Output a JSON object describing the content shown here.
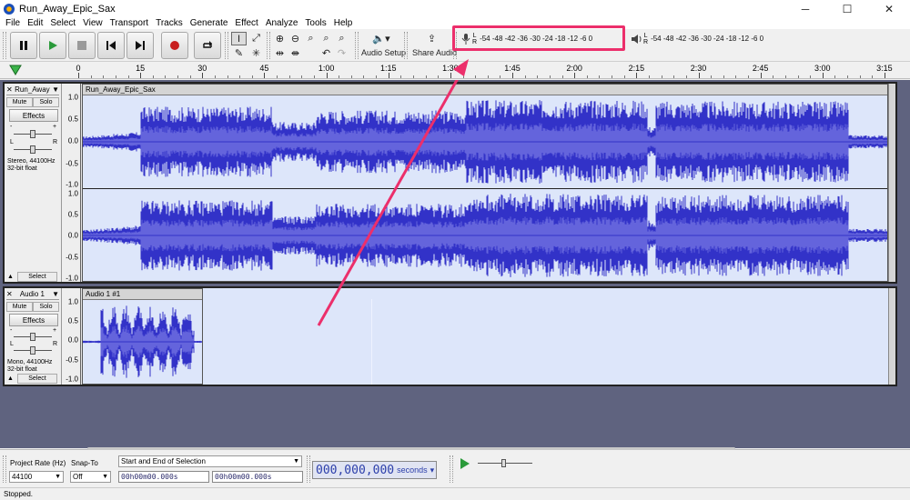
{
  "window": {
    "title": "Run_Away_Epic_Sax",
    "minimize": "─",
    "maximize": "☐",
    "close": "✕"
  },
  "menu": [
    "File",
    "Edit",
    "Select",
    "View",
    "Transport",
    "Tracks",
    "Generate",
    "Effect",
    "Analyze",
    "Tools",
    "Help"
  ],
  "toolbar": {
    "audio_setup_label": "Audio Setup",
    "share_audio_label": "Share Audio",
    "meter_scale": "-54 -48 -42 -36 -30 -24 -18 -12 -6 0",
    "meter_l": "L",
    "meter_r": "R",
    "record_meter_icon": "microphone-icon",
    "play_meter_icon": "speaker-icon"
  },
  "timeline": {
    "labels": [
      "0",
      "15",
      "30",
      "45",
      "1:00",
      "1:15",
      "1:30",
      "1:45",
      "2:00",
      "2:15",
      "2:30",
      "2:45",
      "3:00",
      "3:15"
    ]
  },
  "tracks": [
    {
      "name": "Run_Away",
      "clip_name": "Run_Away_Epic_Sax",
      "mute": "Mute",
      "solo": "Solo",
      "effects": "Effects",
      "select": "Select",
      "info_line1": "Stereo, 44100Hz",
      "info_line2": "32-bit float",
      "gain_minus": "-",
      "gain_plus": "+",
      "pan_l": "L",
      "pan_r": "R",
      "scale": [
        "1.0",
        "0.5",
        "0.0",
        "-0.5",
        "-1.0"
      ],
      "scale2": [
        "1.0",
        "0.5",
        "0.0",
        "-0.5",
        "-1.0"
      ]
    },
    {
      "name": "Audio 1",
      "clip_name": "Audio 1 #1",
      "mute": "Mute",
      "solo": "Solo",
      "effects": "Effects",
      "select": "Select",
      "info_line1": "Mono, 44100Hz",
      "info_line2": "32-bit float",
      "gain_minus": "-",
      "gain_plus": "+",
      "pan_l": "L",
      "pan_r": "R",
      "scale": [
        "1.0",
        "0.5",
        "0.0",
        "-0.5",
        "-1.0"
      ]
    }
  ],
  "selection_bar": {
    "project_rate_label": "Project Rate (Hz)",
    "project_rate": "44100",
    "snap_to_label": "Snap-To",
    "snap_to": "Off",
    "selection_mode": "Start and End of Selection",
    "start_time": "00h00m00.000s",
    "end_time": "00h00m00.000s",
    "audio_position": "000,000,000",
    "audio_position_unit": "seconds"
  },
  "status": "Stopped.",
  "colors": {
    "waveform": "#3232c8",
    "waveform_rms": "#6464dc",
    "clip_bg": "#dde6fa",
    "highlight": "#ec2f6b",
    "track_area": "#5f637f"
  }
}
